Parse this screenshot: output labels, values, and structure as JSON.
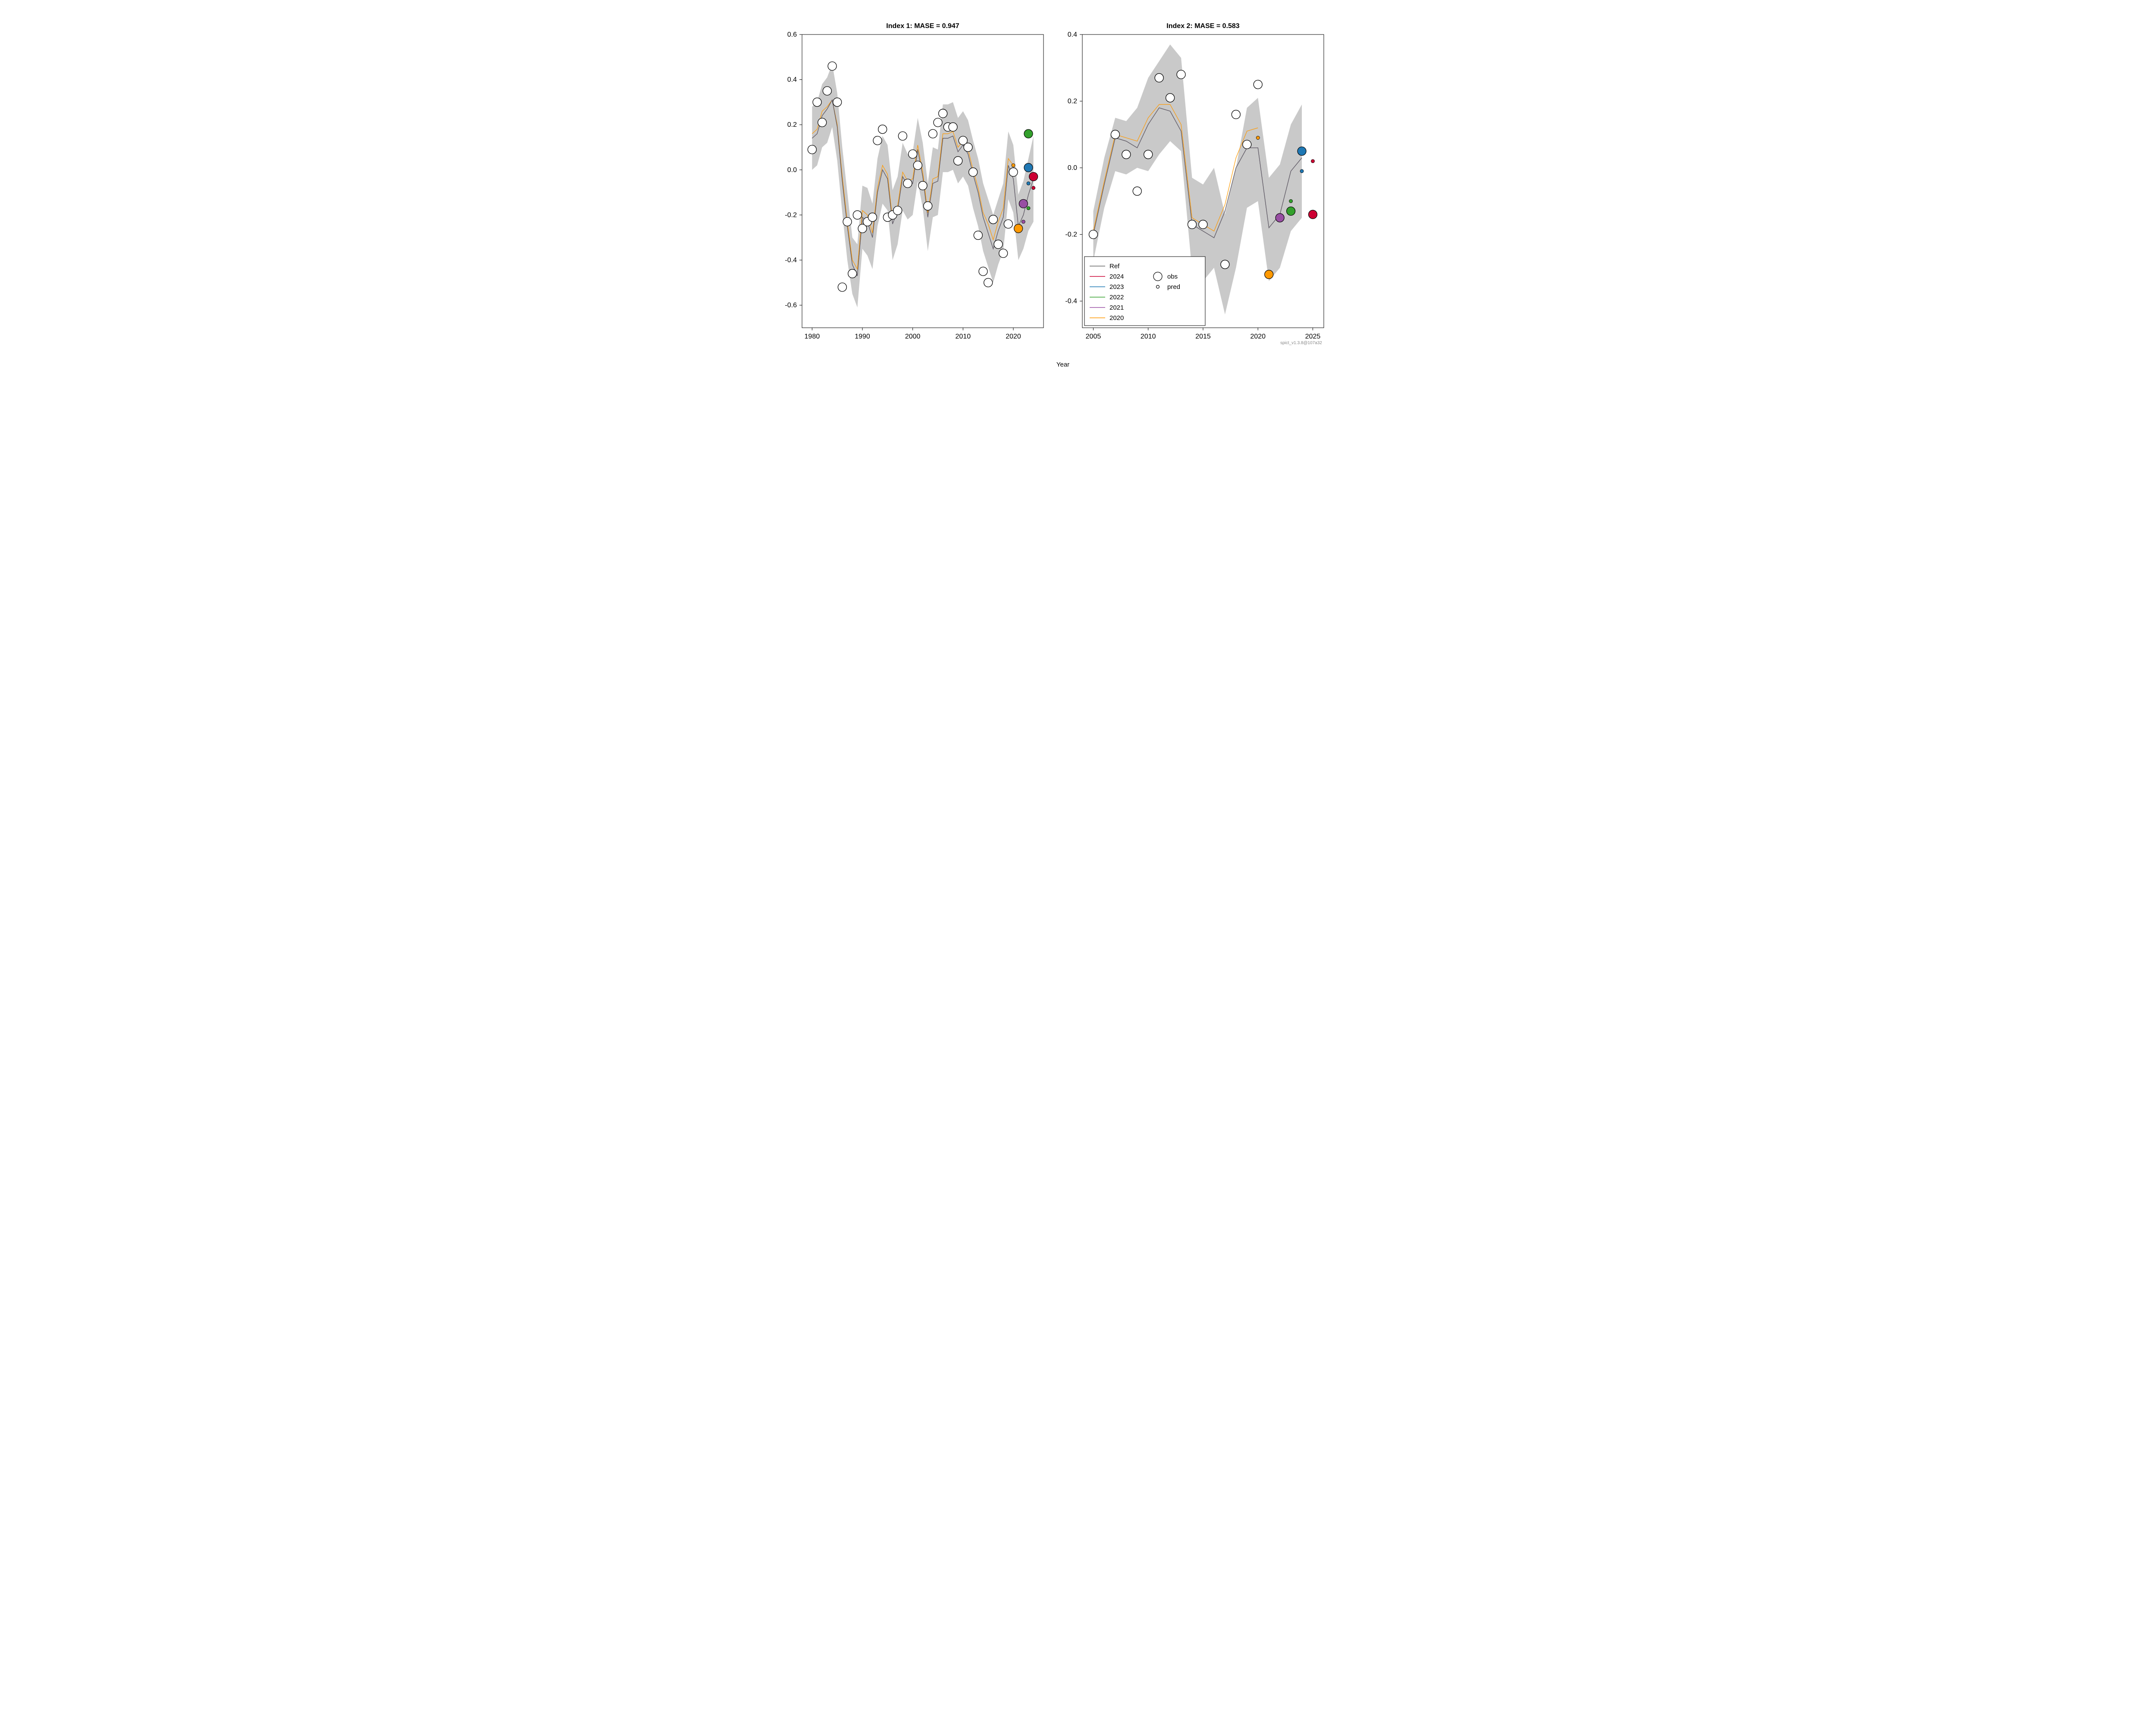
{
  "xlabel": "Year",
  "credit": "spict_v1.3.8@107a32",
  "legend": {
    "lines": [
      {
        "label": "Ref",
        "color": "#666666"
      },
      {
        "label": "2024",
        "color": "#cc0033"
      },
      {
        "label": "2023",
        "color": "#1f78b4"
      },
      {
        "label": "2022",
        "color": "#33a02c"
      },
      {
        "label": "2021",
        "color": "#984ea3"
      },
      {
        "label": "2020",
        "color": "#ff9900"
      }
    ],
    "markers": [
      {
        "label": "obs",
        "r": 10
      },
      {
        "label": "pred",
        "r": 3.5
      }
    ]
  },
  "chart_data": [
    {
      "type": "line",
      "title": "Index 1: MASE = 0.947",
      "xlim": [
        1978,
        2026
      ],
      "ylim": [
        -0.7,
        0.6
      ],
      "xticks": [
        1980,
        1990,
        2000,
        2010,
        2020
      ],
      "yticks": [
        -0.6,
        -0.4,
        -0.2,
        0.0,
        0.2,
        0.4,
        0.6
      ],
      "band": {
        "x": [
          1980,
          1981,
          1982,
          1983,
          1984,
          1985,
          1986,
          1987,
          1988,
          1989,
          1990,
          1991,
          1992,
          1993,
          1994,
          1995,
          1996,
          1997,
          1998,
          1999,
          2000,
          2001,
          2002,
          2003,
          2004,
          2005,
          2006,
          2007,
          2008,
          2009,
          2010,
          2011,
          2012,
          2013,
          2014,
          2015,
          2016,
          2017,
          2018,
          2019,
          2020,
          2021,
          2022,
          2023,
          2024
        ],
        "lo": [
          0.0,
          0.02,
          0.1,
          0.12,
          0.19,
          0.04,
          -0.19,
          -0.4,
          -0.55,
          -0.61,
          -0.35,
          -0.38,
          -0.44,
          -0.25,
          -0.15,
          -0.18,
          -0.4,
          -0.33,
          -0.18,
          -0.22,
          -0.2,
          -0.05,
          -0.17,
          -0.36,
          -0.21,
          -0.2,
          -0.01,
          -0.01,
          0.0,
          -0.06,
          -0.03,
          -0.07,
          -0.17,
          -0.25,
          -0.36,
          -0.43,
          -0.5,
          -0.42,
          -0.36,
          -0.13,
          -0.19,
          -0.4,
          -0.35,
          -0.27,
          -0.23
        ],
        "hi": [
          0.28,
          0.3,
          0.38,
          0.41,
          0.47,
          0.34,
          0.1,
          -0.1,
          -0.3,
          -0.33,
          -0.07,
          -0.08,
          -0.15,
          0.05,
          0.15,
          0.11,
          -0.09,
          -0.03,
          0.12,
          0.07,
          0.08,
          0.23,
          0.12,
          -0.06,
          0.1,
          0.09,
          0.29,
          0.29,
          0.3,
          0.23,
          0.26,
          0.22,
          0.13,
          0.05,
          -0.06,
          -0.13,
          -0.2,
          -0.13,
          -0.06,
          0.17,
          0.11,
          -0.11,
          -0.05,
          0.05,
          0.15
        ]
      },
      "ref": {
        "x": [
          1980,
          1981,
          1982,
          1983,
          1984,
          1985,
          1986,
          1987,
          1988,
          1989,
          1990,
          1991,
          1992,
          1993,
          1994,
          1995,
          1996,
          1997,
          1998,
          1999,
          2000,
          2001,
          2002,
          2003,
          2004,
          2005,
          2006,
          2007,
          2008,
          2009,
          2010,
          2011,
          2012,
          2013,
          2014,
          2015,
          2016,
          2017,
          2018,
          2019,
          2020,
          2021,
          2022,
          2023,
          2024
        ],
        "y": [
          0.14,
          0.16,
          0.24,
          0.27,
          0.31,
          0.19,
          -0.05,
          -0.25,
          -0.42,
          -0.47,
          -0.21,
          -0.23,
          -0.3,
          -0.1,
          0.0,
          -0.04,
          -0.24,
          -0.18,
          -0.03,
          -0.07,
          -0.06,
          0.09,
          -0.03,
          -0.21,
          -0.06,
          -0.05,
          0.14,
          0.14,
          0.15,
          0.08,
          0.11,
          0.07,
          -0.02,
          -0.1,
          -0.21,
          -0.28,
          -0.35,
          -0.27,
          -0.21,
          0.02,
          -0.04,
          -0.25,
          -0.2,
          -0.11,
          -0.04
        ]
      },
      "alt": {
        "x": [
          1980,
          1981,
          1982,
          1983,
          1984,
          1985,
          1986,
          1987,
          1988,
          1989,
          1990,
          1991,
          1992,
          1993,
          1994,
          1995,
          1996,
          1997,
          1998,
          1999,
          2000,
          2001,
          2002,
          2003,
          2004,
          2005,
          2006,
          2007,
          2008,
          2009,
          2010,
          2011,
          2012,
          2013,
          2014,
          2015,
          2016,
          2017,
          2018,
          2019,
          2020
        ],
        "y": [
          0.16,
          0.18,
          0.26,
          0.28,
          0.31,
          0.2,
          -0.03,
          -0.23,
          -0.4,
          -0.44,
          -0.18,
          -0.2,
          -0.28,
          -0.08,
          0.02,
          -0.02,
          -0.22,
          -0.16,
          -0.01,
          -0.05,
          -0.04,
          0.11,
          -0.01,
          -0.19,
          -0.04,
          -0.03,
          0.16,
          0.16,
          0.17,
          0.1,
          0.13,
          0.09,
          0.0,
          -0.08,
          -0.19,
          -0.24,
          -0.31,
          -0.23,
          -0.17,
          0.05,
          0.02
        ]
      },
      "obs": [
        {
          "x": 1980,
          "y": 0.09
        },
        {
          "x": 1981,
          "y": 0.3
        },
        {
          "x": 1982,
          "y": 0.21
        },
        {
          "x": 1983,
          "y": 0.35
        },
        {
          "x": 1984,
          "y": 0.46
        },
        {
          "x": 1985,
          "y": 0.3
        },
        {
          "x": 1986,
          "y": -0.52
        },
        {
          "x": 1987,
          "y": -0.23
        },
        {
          "x": 1988,
          "y": -0.46
        },
        {
          "x": 1989,
          "y": -0.2
        },
        {
          "x": 1990,
          "y": -0.26
        },
        {
          "x": 1991,
          "y": -0.23
        },
        {
          "x": 1992,
          "y": -0.21
        },
        {
          "x": 1993,
          "y": 0.13
        },
        {
          "x": 1994,
          "y": 0.18
        },
        {
          "x": 1995,
          "y": -0.21
        },
        {
          "x": 1996,
          "y": -0.2
        },
        {
          "x": 1997,
          "y": -0.18
        },
        {
          "x": 1998,
          "y": 0.15
        },
        {
          "x": 1999,
          "y": -0.06
        },
        {
          "x": 2000,
          "y": 0.07
        },
        {
          "x": 2001,
          "y": 0.02
        },
        {
          "x": 2002,
          "y": -0.07
        },
        {
          "x": 2003,
          "y": -0.16
        },
        {
          "x": 2004,
          "y": 0.16
        },
        {
          "x": 2005,
          "y": 0.21
        },
        {
          "x": 2006,
          "y": 0.25
        },
        {
          "x": 2007,
          "y": 0.19
        },
        {
          "x": 2008,
          "y": 0.19
        },
        {
          "x": 2009,
          "y": 0.04
        },
        {
          "x": 2010,
          "y": 0.13
        },
        {
          "x": 2011,
          "y": 0.1
        },
        {
          "x": 2012,
          "y": -0.01
        },
        {
          "x": 2013,
          "y": -0.29
        },
        {
          "x": 2014,
          "y": -0.45
        },
        {
          "x": 2015,
          "y": -0.5
        },
        {
          "x": 2016,
          "y": -0.22
        },
        {
          "x": 2017,
          "y": -0.33
        },
        {
          "x": 2018,
          "y": -0.37
        },
        {
          "x": 2019,
          "y": -0.24
        },
        {
          "x": 2020,
          "y": -0.01
        }
      ],
      "pred_small": [
        {
          "x": 2020,
          "y": 0.02,
          "color": "#ff9900"
        },
        {
          "x": 2022,
          "y": -0.23,
          "color": "#984ea3"
        },
        {
          "x": 2023,
          "y": -0.17,
          "color": "#33a02c"
        },
        {
          "x": 2023,
          "y": -0.06,
          "color": "#1f78b4"
        },
        {
          "x": 2024,
          "y": -0.08,
          "color": "#cc0033"
        }
      ],
      "pred_big": [
        {
          "x": 2021,
          "y": -0.26,
          "color": "#ff9900"
        },
        {
          "x": 2022,
          "y": -0.15,
          "color": "#984ea3"
        },
        {
          "x": 2023,
          "y": 0.16,
          "color": "#33a02c"
        },
        {
          "x": 2023,
          "y": 0.01,
          "color": "#1f78b4"
        },
        {
          "x": 2024,
          "y": -0.03,
          "color": "#cc0033"
        }
      ]
    },
    {
      "type": "line",
      "title": "Index 2: MASE = 0.583",
      "xlim": [
        2004,
        2026
      ],
      "ylim": [
        -0.48,
        0.4
      ],
      "xticks": [
        2005,
        2010,
        2015,
        2020,
        2025
      ],
      "yticks": [
        -0.4,
        -0.2,
        0.0,
        0.2,
        0.4
      ],
      "band": {
        "x": [
          2005,
          2006,
          2007,
          2008,
          2009,
          2010,
          2011,
          2012,
          2013,
          2014,
          2015,
          2016,
          2017,
          2018,
          2019,
          2020,
          2021,
          2022,
          2023,
          2024
        ],
        "lo": [
          -0.28,
          -0.12,
          -0.01,
          -0.02,
          0.0,
          -0.01,
          0.04,
          0.08,
          0.05,
          -0.31,
          -0.34,
          -0.3,
          -0.44,
          -0.3,
          -0.12,
          -0.1,
          -0.34,
          -0.3,
          -0.19,
          -0.15
        ],
        "hi": [
          -0.13,
          0.03,
          0.15,
          0.14,
          0.18,
          0.27,
          0.32,
          0.37,
          0.33,
          -0.03,
          -0.05,
          0.0,
          -0.14,
          0.0,
          0.18,
          0.21,
          -0.03,
          0.01,
          0.13,
          0.19
        ]
      },
      "ref": {
        "x": [
          2005,
          2006,
          2007,
          2008,
          2009,
          2010,
          2011,
          2012,
          2013,
          2014,
          2015,
          2016,
          2017,
          2018,
          2019,
          2020,
          2021,
          2022,
          2023,
          2024
        ],
        "y": [
          -0.2,
          -0.05,
          0.09,
          0.08,
          0.06,
          0.13,
          0.18,
          0.17,
          0.11,
          -0.17,
          -0.19,
          -0.21,
          -0.13,
          0.0,
          0.06,
          0.06,
          -0.18,
          -0.14,
          -0.01,
          0.03
        ]
      },
      "alt": {
        "x": [
          2005,
          2006,
          2007,
          2008,
          2009,
          2010,
          2011,
          2012,
          2013,
          2014,
          2015,
          2016,
          2017,
          2018,
          2019,
          2020
        ],
        "y": [
          -0.19,
          -0.04,
          0.1,
          0.09,
          0.08,
          0.15,
          0.19,
          0.19,
          0.13,
          -0.15,
          -0.17,
          -0.19,
          -0.11,
          0.03,
          0.11,
          0.12
        ]
      },
      "obs": [
        {
          "x": 2005,
          "y": -0.2
        },
        {
          "x": 2007,
          "y": 0.1
        },
        {
          "x": 2008,
          "y": 0.04
        },
        {
          "x": 2009,
          "y": -0.07
        },
        {
          "x": 2010,
          "y": 0.04
        },
        {
          "x": 2011,
          "y": 0.27
        },
        {
          "x": 2012,
          "y": 0.21
        },
        {
          "x": 2013,
          "y": 0.28
        },
        {
          "x": 2014,
          "y": -0.17
        },
        {
          "x": 2015,
          "y": -0.17
        },
        {
          "x": 2017,
          "y": -0.29
        },
        {
          "x": 2018,
          "y": 0.16
        },
        {
          "x": 2019,
          "y": 0.07
        },
        {
          "x": 2020,
          "y": 0.25
        }
      ],
      "pred_small": [
        {
          "x": 2020,
          "y": 0.09,
          "color": "#ff9900"
        },
        {
          "x": 2023,
          "y": -0.1,
          "color": "#33a02c"
        },
        {
          "x": 2024,
          "y": -0.01,
          "color": "#1f78b4"
        },
        {
          "x": 2025,
          "y": 0.02,
          "color": "#cc0033"
        }
      ],
      "pred_big": [
        {
          "x": 2021,
          "y": -0.32,
          "color": "#ff9900"
        },
        {
          "x": 2022,
          "y": -0.15,
          "color": "#984ea3"
        },
        {
          "x": 2023,
          "y": -0.13,
          "color": "#33a02c"
        },
        {
          "x": 2024,
          "y": 0.05,
          "color": "#1f78b4"
        },
        {
          "x": 2025,
          "y": -0.14,
          "color": "#cc0033"
        }
      ]
    }
  ]
}
